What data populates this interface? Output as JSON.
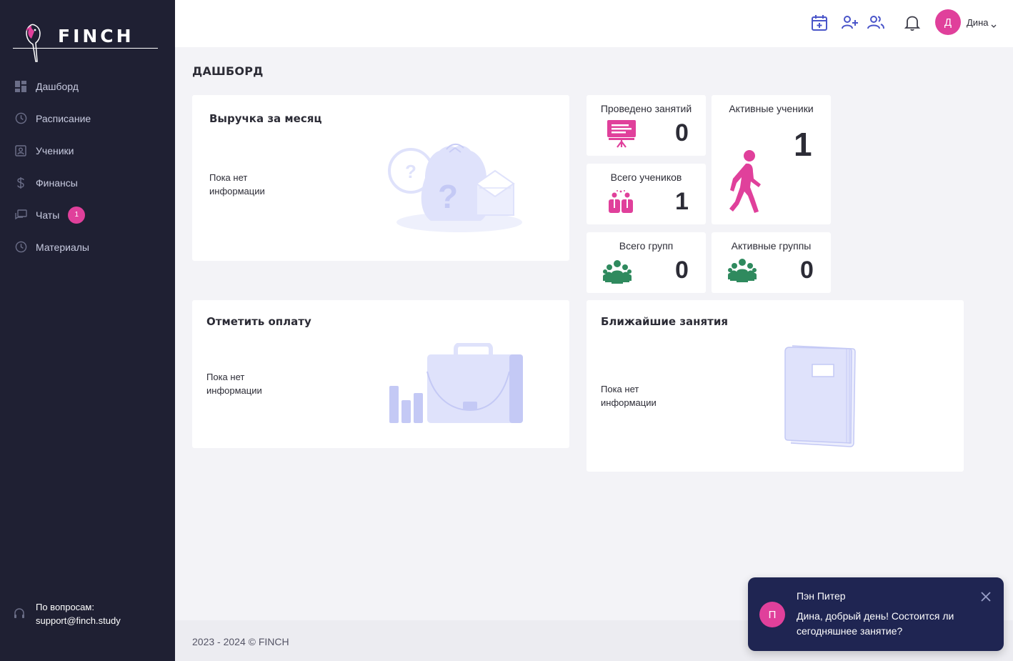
{
  "brand": {
    "name": "FINCH"
  },
  "sidebar": {
    "items": [
      {
        "label": "Дашборд",
        "icon": "dashboard-icon"
      },
      {
        "label": "Расписание",
        "icon": "clock-icon"
      },
      {
        "label": "Ученики",
        "icon": "student-icon"
      },
      {
        "label": "Финансы",
        "icon": "dollar-icon"
      },
      {
        "label": "Чаты",
        "icon": "chat-icon",
        "badge": "1"
      },
      {
        "label": "Материалы",
        "icon": "clock-icon"
      }
    ],
    "support_label": "По вопросам:",
    "support_email": "support@finch.study"
  },
  "topbar": {
    "icons": [
      "calendar-add-icon",
      "add-user-icon",
      "users-icon",
      "bell-icon"
    ],
    "avatar_initial": "Д",
    "user_name": "Дина"
  },
  "page": {
    "title": "ДАШБОРД"
  },
  "cards": {
    "revenue": {
      "title": "Выручка за месяц",
      "empty": "Пока нет информации"
    },
    "payment": {
      "title": "Отметить оплату",
      "empty": "Пока нет информации"
    },
    "upcoming": {
      "title": "Ближайшие занятия",
      "empty": "Пока нет информации"
    }
  },
  "stats": {
    "lessons": {
      "label": "Проведено занятий",
      "value": "0"
    },
    "active_students": {
      "label": "Активные ученики",
      "value": "1"
    },
    "total_students": {
      "label": "Всего учеников",
      "value": "1"
    },
    "total_groups": {
      "label": "Всего групп",
      "value": "0"
    },
    "active_groups": {
      "label": "Активные группы",
      "value": "0"
    }
  },
  "footer": {
    "text": "2023 - 2024 © FINCH"
  },
  "toast": {
    "avatar_initial": "П",
    "sender": "Пэн Питер",
    "message": "Дина, добрый день! Состоится ли сегодняшнее занятие?"
  },
  "colors": {
    "sidebar": "#1f2033",
    "accent_pink": "#e0409b",
    "accent_blue": "#4a55c9",
    "green": "#2f8a5e",
    "illustration": "#dfe2fb"
  }
}
